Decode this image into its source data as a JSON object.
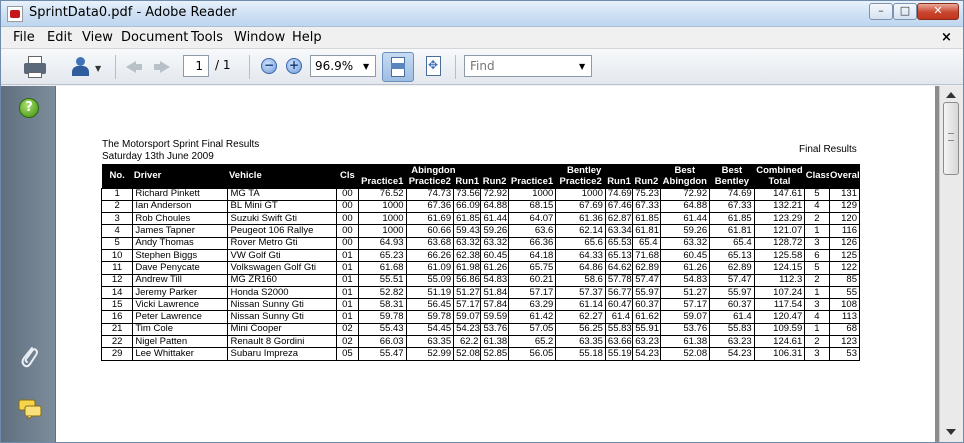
{
  "window": {
    "title": "SprintData0.pdf - Adobe Reader"
  },
  "menu": {
    "items": [
      "File",
      "Edit",
      "View",
      "Document",
      "Tools",
      "Window",
      "Help"
    ],
    "close_glyph": "×"
  },
  "toolbar": {
    "page_current": "1",
    "page_total": "/ 1",
    "zoom": "96.9%",
    "find_placeholder": "Find"
  },
  "document": {
    "title": "The Motorsport Sprint Final Results",
    "date": "Saturday 13th June 2009",
    "right_heading": "Final Results",
    "table": {
      "group_headers": {
        "abingdon": "Abingdon",
        "bentley": "Bentley",
        "best_abingdon": "Best",
        "best_bentley": "Best",
        "combined": "Combined"
      },
      "headers": [
        "No.",
        "Driver",
        "Vehicle",
        "Cls",
        "Practice1",
        "Practice2",
        "Run1",
        "Run2",
        "Practice1",
        "Practice2",
        "Run1",
        "Run2",
        "Abingdon",
        "Bentley",
        "Total",
        "Class",
        "Overall"
      ],
      "rows": [
        [
          "1",
          "Richard Pinkett",
          "MG TA",
          "00",
          "76.52",
          "74.73",
          "73.56",
          "72.92",
          "1000",
          "1000",
          "74.69",
          "75.23",
          "72.92",
          "74.69",
          "147.61",
          "5",
          "131"
        ],
        [
          "2",
          "Ian Anderson",
          "BL Mini GT",
          "00",
          "1000",
          "67.36",
          "66.09",
          "64.88",
          "68.15",
          "67.69",
          "67.46",
          "67.33",
          "64.88",
          "67.33",
          "132.21",
          "4",
          "129"
        ],
        [
          "3",
          "Rob Choules",
          "Suzuki Swift Gti",
          "00",
          "1000",
          "61.69",
          "61.85",
          "61.44",
          "64.07",
          "61.36",
          "62.87",
          "61.85",
          "61.44",
          "61.85",
          "123.29",
          "2",
          "120"
        ],
        [
          "4",
          "James Tapner",
          "Peugeot 106 Rallye",
          "00",
          "1000",
          "60.66",
          "59.43",
          "59.26",
          "63.6",
          "62.14",
          "63.34",
          "61.81",
          "59.26",
          "61.81",
          "121.07",
          "1",
          "116"
        ],
        [
          "5",
          "Andy Thomas",
          "Rover Metro Gti",
          "00",
          "64.93",
          "63.68",
          "63.32",
          "63.32",
          "66.36",
          "65.6",
          "65.53",
          "65.4",
          "63.32",
          "65.4",
          "128.72",
          "3",
          "126"
        ],
        [
          "10",
          "Stephen Biggs",
          "VW Golf Gti",
          "01",
          "65.23",
          "66.26",
          "62.38",
          "60.45",
          "64.18",
          "64.33",
          "65.13",
          "71.68",
          "60.45",
          "65.13",
          "125.58",
          "6",
          "125"
        ],
        [
          "11",
          "Dave Penycate",
          "Volkswagen Golf Gti",
          "01",
          "61.68",
          "61.09",
          "61.98",
          "61.26",
          "65.75",
          "64.86",
          "64.62",
          "62.89",
          "61.26",
          "62.89",
          "124.15",
          "5",
          "122"
        ],
        [
          "12",
          "Andrew Till",
          "MG ZR160",
          "01",
          "55.51",
          "55.09",
          "56.86",
          "54.83",
          "60.21",
          "58.6",
          "57.78",
          "57.47",
          "54.83",
          "57.47",
          "112.3",
          "2",
          "85"
        ],
        [
          "14",
          "Jeremy Parker",
          "Honda S2000",
          "01",
          "52.82",
          "51.19",
          "51.27",
          "51.84",
          "57.17",
          "57.37",
          "56.77",
          "55.97",
          "51.27",
          "55.97",
          "107.24",
          "1",
          "55"
        ],
        [
          "15",
          "Vicki Lawrence",
          "Nissan Sunny Gti",
          "01",
          "58.31",
          "56.45",
          "57.17",
          "57.84",
          "63.29",
          "61.14",
          "60.47",
          "60.37",
          "57.17",
          "60.37",
          "117.54",
          "3",
          "108"
        ],
        [
          "16",
          "Peter Lawrence",
          "Nissan Sunny Gti",
          "01",
          "59.78",
          "59.78",
          "59.07",
          "59.59",
          "61.42",
          "62.27",
          "61.4",
          "61.62",
          "59.07",
          "61.4",
          "120.47",
          "4",
          "113"
        ],
        [
          "21",
          "Tim Cole",
          "Mini Cooper",
          "02",
          "55.43",
          "54.45",
          "54.23",
          "53.76",
          "57.05",
          "56.25",
          "55.83",
          "55.91",
          "53.76",
          "55.83",
          "109.59",
          "1",
          "68"
        ],
        [
          "22",
          "Nigel Patten",
          "Renault 8 Gordini",
          "02",
          "66.03",
          "63.35",
          "62.2",
          "61.38",
          "65.2",
          "63.35",
          "63.66",
          "63.23",
          "61.38",
          "63.23",
          "124.61",
          "2",
          "123"
        ],
        [
          "29",
          "Lee Whittaker",
          "Subaru Impreza",
          "05",
          "55.47",
          "52.99",
          "52.08",
          "52.85",
          "56.05",
          "55.18",
          "55.19",
          "54.23",
          "52.08",
          "54.23",
          "106.31",
          "3",
          "53"
        ]
      ]
    }
  }
}
